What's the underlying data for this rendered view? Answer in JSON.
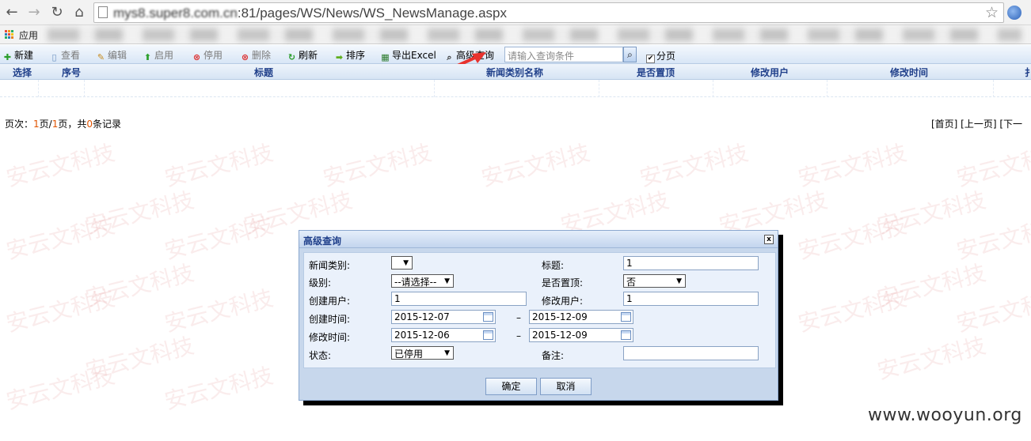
{
  "browser": {
    "url_host": "mys8.super8.com.cn",
    "url_rest": ":81/pages/WS/News/WS_NewsManage.aspx",
    "apps_label": "应用"
  },
  "toolbar": {
    "new": "新建",
    "view": "查看",
    "edit": "编辑",
    "enable": "启用",
    "disable": "停用",
    "delete": "删除",
    "refresh": "刷新",
    "sort": "排序",
    "export": "导出Excel",
    "advanced": "高级查询",
    "search_placeholder": "请输入查询条件",
    "paging": "分页"
  },
  "grid": {
    "columns": [
      "选择",
      "序号",
      "标题",
      "新闻类别名称",
      "是否置顶",
      "修改用户",
      "修改时间",
      "扌"
    ]
  },
  "pager": {
    "prefix": "页次：",
    "page": "1",
    "page_sep": "页/",
    "total_pages": "1",
    "mid": "页，共",
    "records": "0",
    "suffix": "条记录",
    "nav": "[首页] [上一页] [下一"
  },
  "dialog": {
    "title": "高级查询",
    "close_glyph": "x",
    "fields": {
      "category_label": "新闻类别:",
      "category_value": "",
      "title_label": "标题:",
      "title_value": "1",
      "level_label": "级别:",
      "level_value": "--请选择--",
      "top_label": "是否置顶:",
      "top_value": "否",
      "creator_label": "创建用户:",
      "creator_value": "1",
      "modifier_label": "修改用户:",
      "modifier_value": "1",
      "created_label": "创建时间:",
      "created_from": "2015-12-07",
      "created_to": "2015-12-09",
      "modified_label": "修改时间:",
      "modified_from": "2015-12-06",
      "modified_to": "2015-12-09",
      "status_label": "状态:",
      "status_value": "已停用",
      "remark_label": "备注:",
      "remark_value": "",
      "range_sep": "–"
    },
    "ok": "确定",
    "cancel": "取消"
  },
  "watermark": {
    "text": "安云文科技",
    "site": "www.wooyun.org"
  },
  "colors": {
    "toolbar_bg": "#d8e6f6",
    "header_text": "#1f3f8a",
    "pager_number": "#e05300",
    "dialog_bg": "#c7d7ec",
    "arrow": "#e8322d"
  }
}
